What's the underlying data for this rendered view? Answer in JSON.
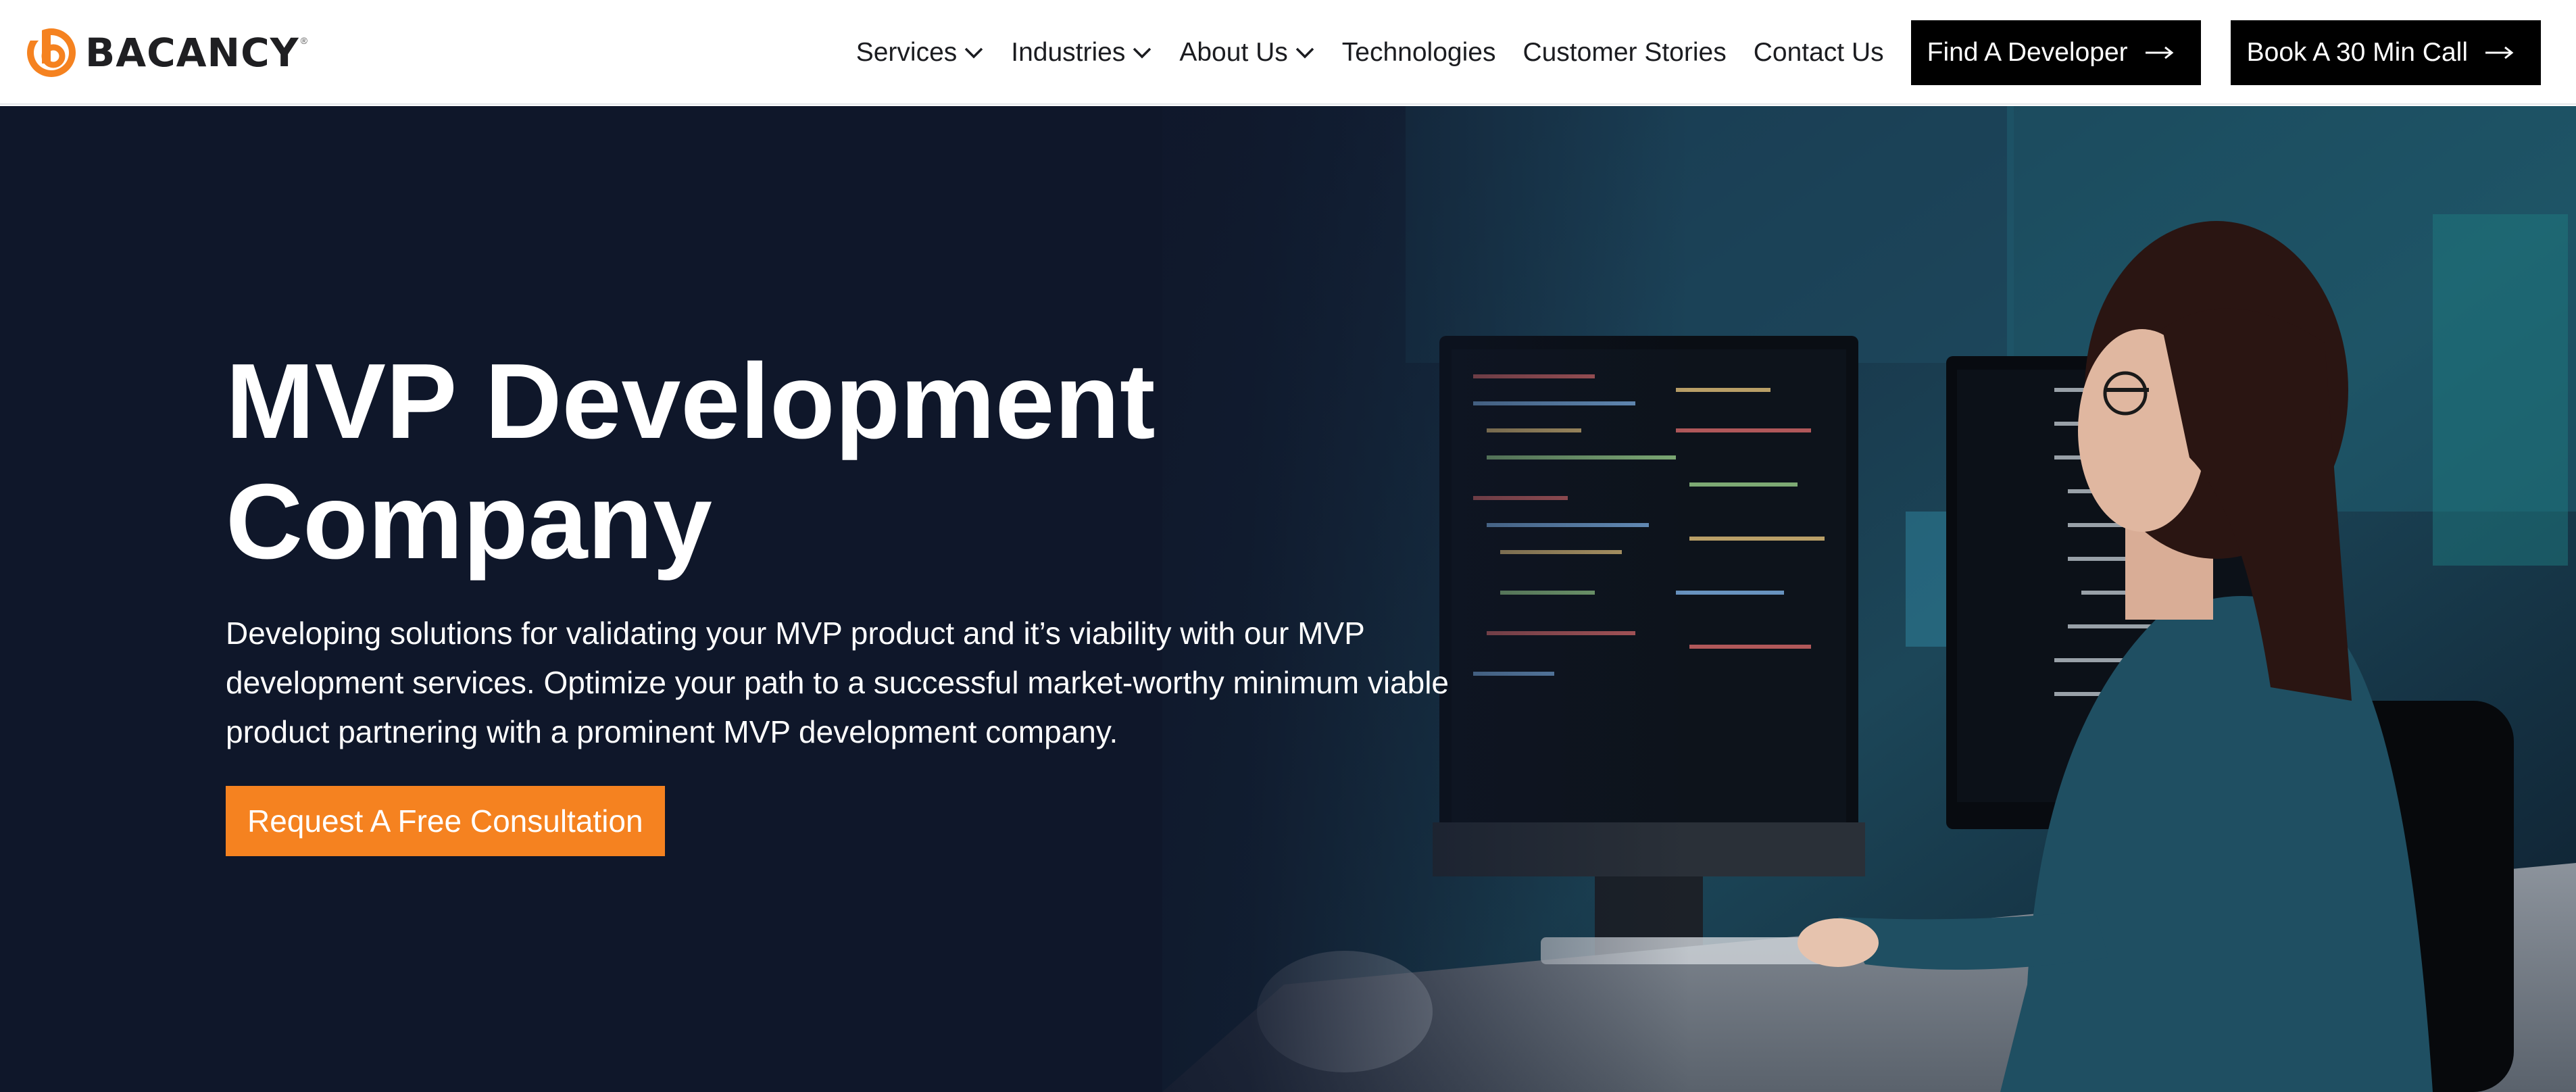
{
  "brand": {
    "name": "BACANCY",
    "registered": "®",
    "accent_color": "#f58220",
    "logo_icon": "bacancy-logo-icon"
  },
  "nav": {
    "items": [
      {
        "label": "Services",
        "has_dropdown": true
      },
      {
        "label": "Industries",
        "has_dropdown": true
      },
      {
        "label": "About Us",
        "has_dropdown": true
      },
      {
        "label": "Technologies",
        "has_dropdown": false
      },
      {
        "label": "Customer Stories",
        "has_dropdown": false
      },
      {
        "label": "Contact Us",
        "has_dropdown": false
      }
    ],
    "find_developer_label": "Find A Developer",
    "book_call_label": "Book A 30 Min Call",
    "dropdown_icon": "chevron-down-icon",
    "button_icon": "arrow-right-icon"
  },
  "hero": {
    "title_line1": "MVP Development",
    "title_line2": "Company",
    "description": "Developing solutions for validating your MVP product and it’s viability with our MVP development services. Optimize your path to a successful market-worthy minimum viable product partnering with a prominent MVP development company.",
    "cta_label": "Request A Free Consultation",
    "background_color": "#0f172a"
  }
}
